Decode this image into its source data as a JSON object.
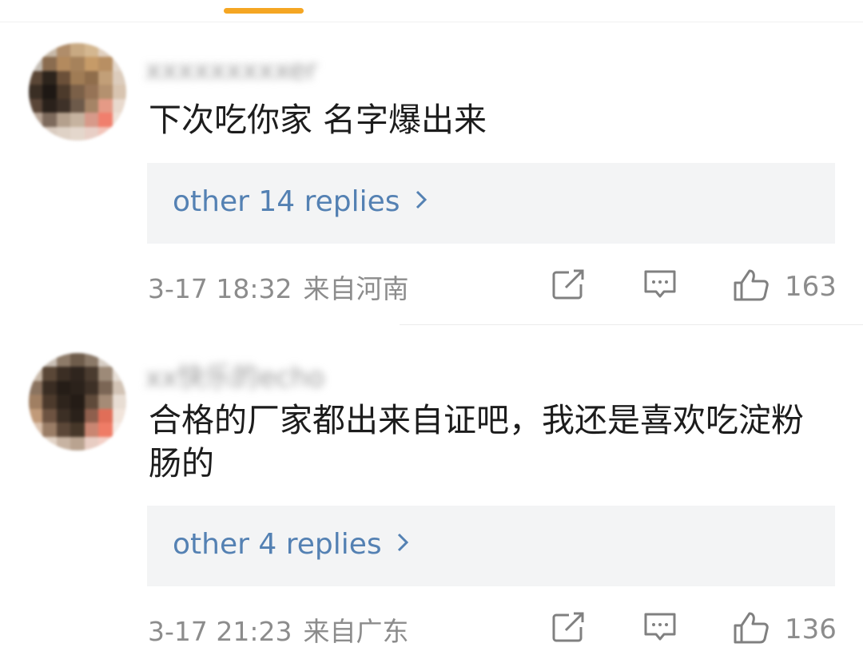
{
  "colors": {
    "accent": "#f5a623",
    "link": "#5481b3",
    "meta": "#8c8c8c",
    "reply_box_bg": "#f3f4f5"
  },
  "comments": [
    {
      "username": "xxxxxxxxxer",
      "text": "下次吃你家 名字爆出来",
      "replies_label": "other 14 replies",
      "date": "3-17 18:32",
      "location": "来自河南",
      "likes": "163",
      "icons": [
        "share-icon",
        "comment-icon",
        "thumbs-up-icon"
      ]
    },
    {
      "username": "xx快乐的echo",
      "text": "合格的厂家都出来自证吧，我还是喜欢吃淀粉肠的",
      "replies_label": "other 4 replies",
      "date": "3-17 21:23",
      "location": "来自广东",
      "likes": "136",
      "icons": [
        "share-icon",
        "comment-icon",
        "thumbs-up-icon"
      ]
    }
  ]
}
